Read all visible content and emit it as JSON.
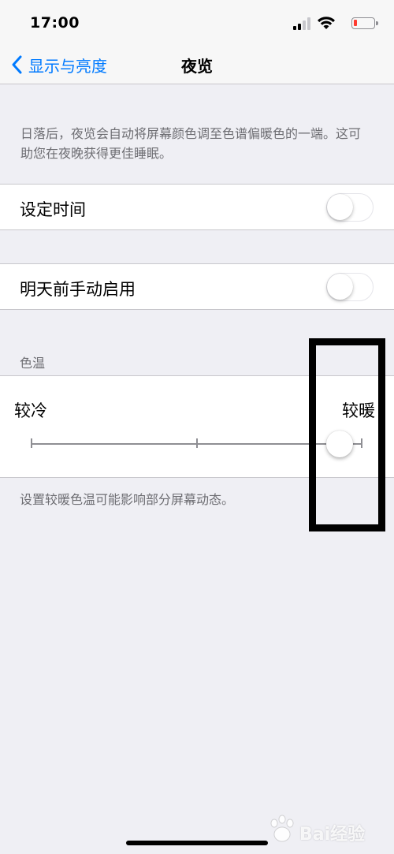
{
  "status_bar": {
    "time": "17:00",
    "icons": [
      "signal-icon",
      "wifi-icon",
      "battery-low-icon"
    ],
    "battery_color": "#ff3b30"
  },
  "nav": {
    "back_label": "显示与亮度",
    "back_icon": "chevron-left-icon",
    "title": "夜览"
  },
  "description": "日落后，夜览会自动将屏幕颜色调至色谱偏暖色的一端。这可助您在夜晚获得更佳睡眠。",
  "cells": {
    "scheduled": {
      "label": "设定时间",
      "on": false
    },
    "manual": {
      "label": "明天前手动启用",
      "on": false
    }
  },
  "color_temperature": {
    "header": "色温",
    "min_label": "较冷",
    "max_label": "较暖",
    "value_fraction": 0.93,
    "footer": "设置较暖色温可能影响部分屏幕动态。"
  },
  "watermark": {
    "text": "Bai经验",
    "icon": "baidu-paw-icon"
  },
  "colors": {
    "accent": "#007aff",
    "background": "#efeff4",
    "secondary_text": "#6d6d72"
  }
}
